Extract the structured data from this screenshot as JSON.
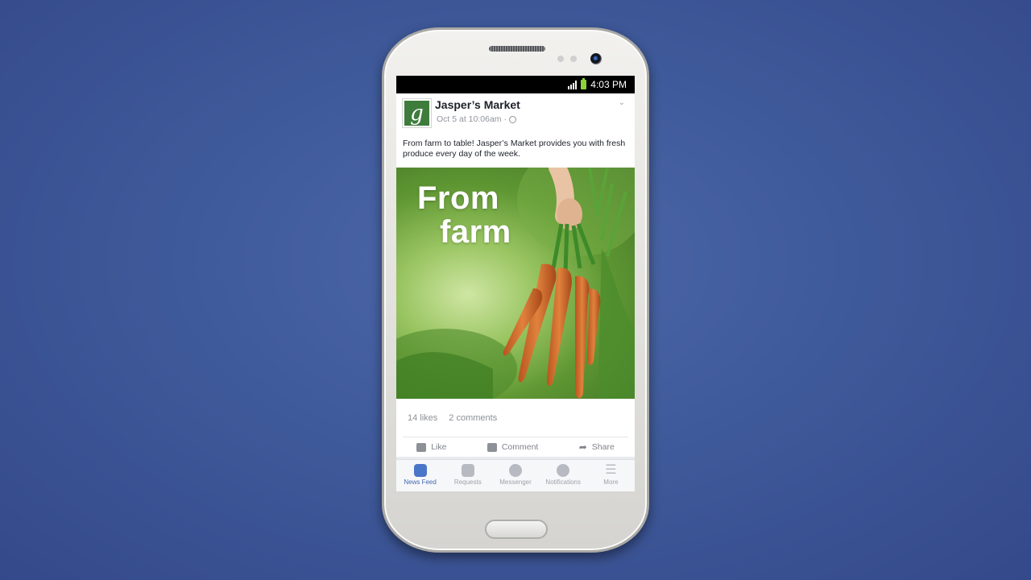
{
  "status_bar": {
    "time": "4:03 PM"
  },
  "post": {
    "page_name": "Jasper’s Market",
    "avatar_letter": "g",
    "timestamp": "Oct 5 at 10:06am ·",
    "text": "From farm to table! Jasper’s Market provides you with fresh produce every day of the week.",
    "image_caption_line1": "From",
    "image_caption_line2": "farm",
    "likes": "14 likes",
    "comments": "2 comments",
    "actions": {
      "like": "Like",
      "comment": "Comment",
      "share": "Share"
    }
  },
  "tab_bar": [
    {
      "label": "News Feed",
      "icon": "news-feed-icon",
      "active": true
    },
    {
      "label": "Requests",
      "icon": "friends-icon",
      "active": false
    },
    {
      "label": "Messenger",
      "icon": "messenger-icon",
      "active": false
    },
    {
      "label": "Notifications",
      "icon": "globe-icon",
      "active": false
    },
    {
      "label": "More",
      "icon": "menu-icon",
      "active": false
    }
  ],
  "colors": {
    "brand_blue": "#3b5998",
    "page_green": "#3e7c3c",
    "battery_green": "#8ed23b"
  }
}
